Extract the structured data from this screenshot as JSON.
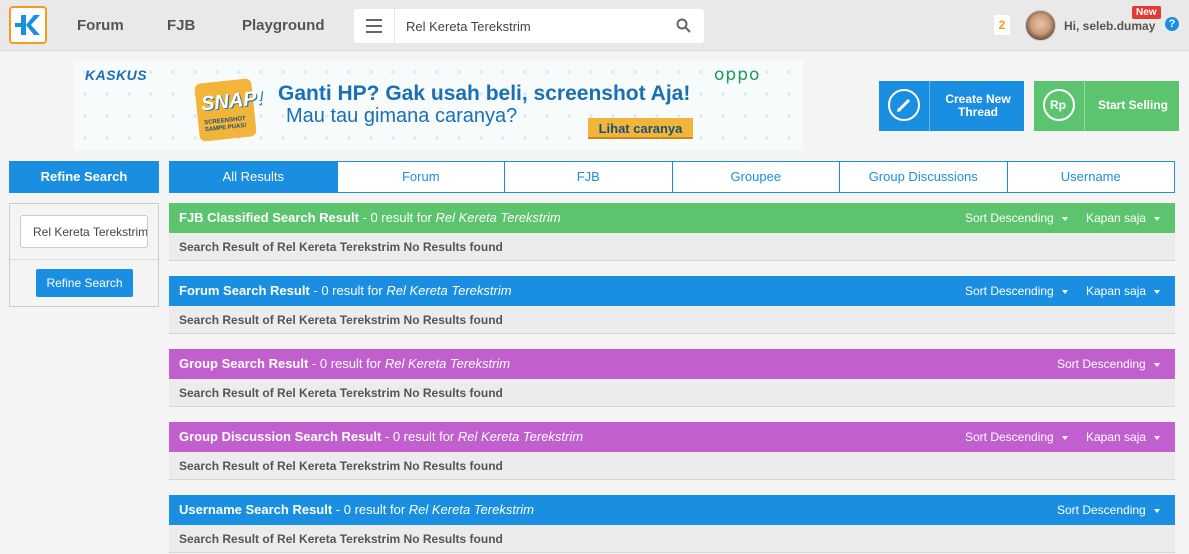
{
  "header": {
    "nav": [
      "Forum",
      "FJB",
      "Playground"
    ],
    "search_value": "Rel Kereta Terekstrim",
    "notification_count": "2",
    "user_greeting": "Hi, seleb.dumay",
    "new_badge": "New",
    "help": "?"
  },
  "banner": {
    "brand_left": "KASKUS",
    "brand_right": "oppo",
    "badge": "SNAP!",
    "badge_sub": "SCREENSHOT SAMPE PUAS!",
    "line1": "Ganti HP? Gak usah beli, screenshot Aja!",
    "line2": "Mau tau gimana caranya?",
    "cta": "Lihat caranya"
  },
  "actions": {
    "create_line1": "Create New",
    "create_line2": "Thread",
    "sell": "Start Selling",
    "sell_icon_text": "Rp"
  },
  "sidebar": {
    "title": "Refine Search",
    "input_value": "Rel Kereta Terekstrim",
    "button": "Refine Search"
  },
  "tabs": [
    "All Results",
    "Forum",
    "FJB",
    "Groupee",
    "Group Discussions",
    "Username"
  ],
  "sections": [
    {
      "title": "FJB Classified Search Result",
      "count_text": " - 0 result for ",
      "query": "Rel Kereta Terekstrim",
      "sort": "Sort Descending",
      "time": "Kapan saja",
      "empty": "Search Result of Rel Kereta Terekstrim No Results found",
      "color": "#5cc46e"
    },
    {
      "title": "Forum Search Result",
      "count_text": " - 0 result for ",
      "query": "Rel Kereta Terekstrim",
      "sort": "Sort Descending",
      "time": "Kapan saja",
      "empty": "Search Result of Rel Kereta Terekstrim No Results found",
      "color": "#1a8ee0"
    },
    {
      "title": "Group Search Result",
      "count_text": " - 0 result for ",
      "query": "Rel Kereta Terekstrim",
      "sort": "Sort Descending",
      "time": "",
      "empty": "Search Result of Rel Kereta Terekstrim No Results found",
      "color": "#c25fcf"
    },
    {
      "title": "Group Discussion Search Result",
      "count_text": " - 0 result for ",
      "query": "Rel Kereta Terekstrim",
      "sort": "Sort Descending",
      "time": "Kapan saja",
      "empty": "Search Result of Rel Kereta Terekstrim No Results found",
      "color": "#c25fcf"
    },
    {
      "title": "Username Search Result",
      "count_text": " - 0 result for ",
      "query": "Rel Kereta Terekstrim",
      "sort": "Sort Descending",
      "time": "",
      "empty": "Search Result of Rel Kereta Terekstrim No Results found",
      "color": "#1a8ee0"
    }
  ]
}
